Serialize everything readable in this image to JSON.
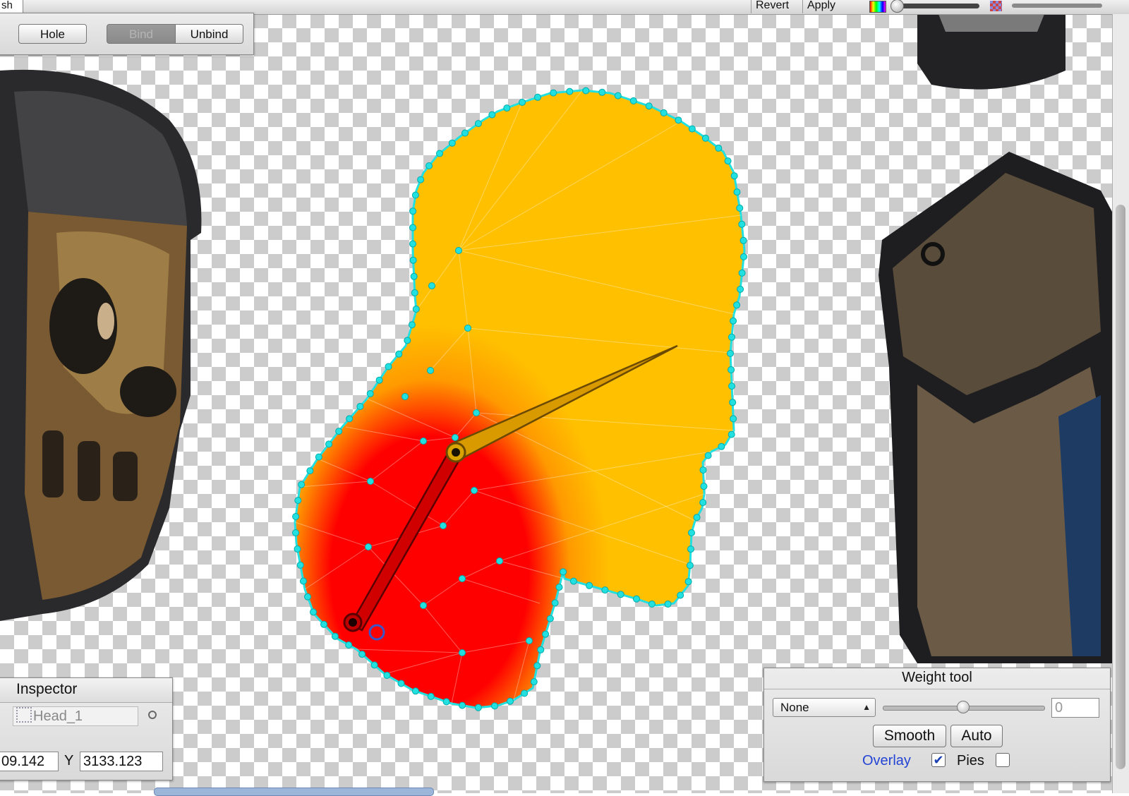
{
  "toolbar": {
    "tab_partial": "sh",
    "revert_label": "Revert",
    "apply_label": "Apply",
    "icons": [
      "color-swatch-icon",
      "zoom-slider",
      "checker-icon"
    ]
  },
  "mesh_panel": {
    "hole_label": "Hole",
    "bind_label": "Bind",
    "unbind_label": "Unbind"
  },
  "inspector": {
    "title": "Inspector",
    "object_name": "Head_1",
    "x_value": "09.142",
    "y_label": "Y",
    "y_value": "3133.123"
  },
  "weight_tool": {
    "title": "Weight tool",
    "bone_select": "None",
    "weight_value": "0",
    "weight_level": 0.5,
    "smooth_label": "Smooth",
    "auto_label": "Auto",
    "overlay_label": "Overlay",
    "overlay_checked": true,
    "pies_label": "Pies",
    "pies_checked": false
  },
  "colors": {
    "weight_high": "#ff0000",
    "weight_low": "#ffc000",
    "vertex": "#22e0e0",
    "bone": "#6b4a00"
  }
}
